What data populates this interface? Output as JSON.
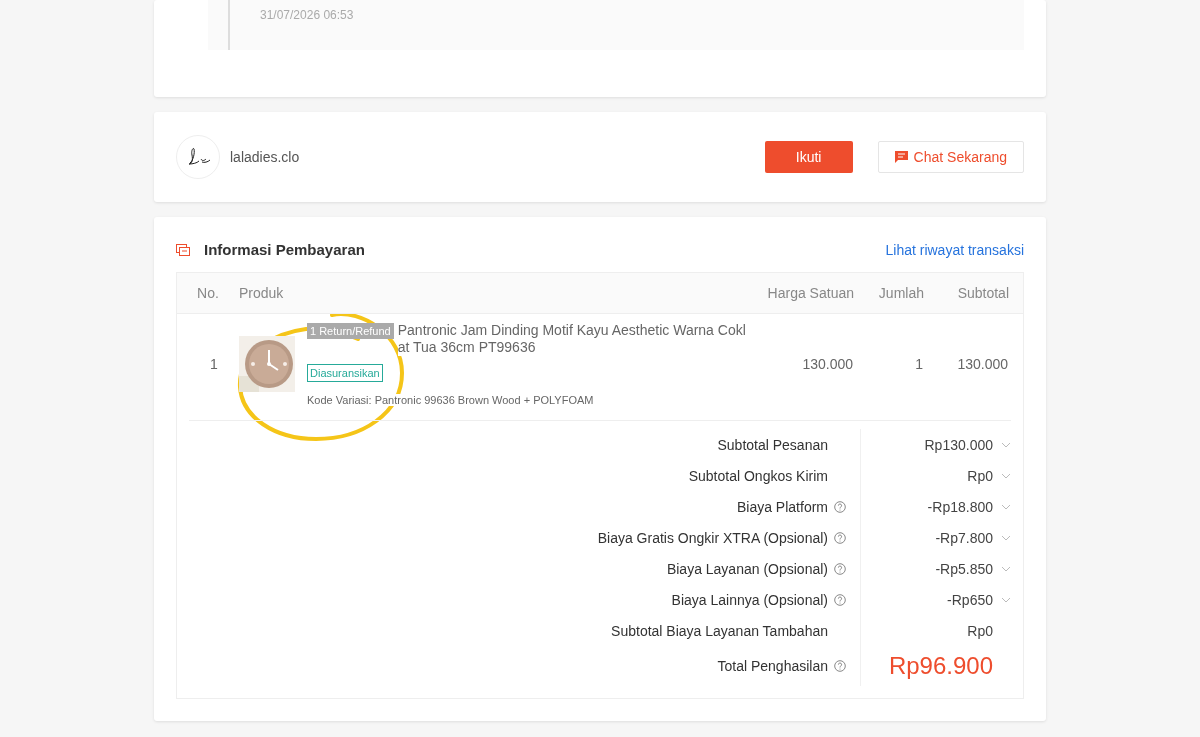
{
  "timeline": {
    "events": [
      {
        "time": "31/07/2026 06:53"
      }
    ]
  },
  "shop": {
    "name": "laladies.clo",
    "follow_button": "Ikuti",
    "chat_button": "Chat Sekarang"
  },
  "payment": {
    "title": "Informasi Pembayaran",
    "history_link": "Lihat riwayat transaksi",
    "columns": [
      "No.",
      "Produk",
      "Harga Satuan",
      "Jumlah",
      "Subtotal"
    ],
    "items": [
      {
        "no": "1",
        "badge": "1 Return/Refund",
        "name": "Pantronic Jam Dinding Motif Kayu Aesthetic Warna Coklat Tua 36cm PT99636",
        "tag": "Diasuransikan",
        "variation": "Kode Variasi: Pantronic 99636 Brown Wood + POLYFOAM",
        "unit_price": "130.000",
        "qty": "1",
        "subtotal": "130.000"
      }
    ],
    "summary": [
      {
        "kind": "line",
        "label": "Subtotal Pesanan",
        "value": "Rp130.000",
        "info": false,
        "expandable": true
      },
      {
        "kind": "line",
        "label": "Subtotal Ongkos Kirim",
        "value": "Rp0",
        "info": false,
        "expandable": true
      },
      {
        "kind": "line",
        "label": "Biaya Platform",
        "value": "-Rp18.800",
        "info": true,
        "expandable": true
      },
      {
        "kind": "line",
        "label": "Biaya Gratis Ongkir XTRA (Opsional)",
        "value": "-Rp7.800",
        "info": true,
        "expandable": true
      },
      {
        "kind": "line",
        "label": "Biaya Layanan (Opsional)",
        "value": "-Rp5.850",
        "info": true,
        "expandable": true
      },
      {
        "kind": "line",
        "label": "Biaya Lainnya (Opsional)",
        "value": "-Rp650",
        "info": true,
        "expandable": true
      },
      {
        "kind": "line",
        "label": "Subtotal Biaya Layanan Tambahan",
        "value": "Rp0",
        "info": false,
        "expandable": false
      },
      {
        "kind": "total",
        "label": "Total Penghasilan",
        "value": "Rp96.900",
        "info": true,
        "expandable": false
      }
    ]
  }
}
